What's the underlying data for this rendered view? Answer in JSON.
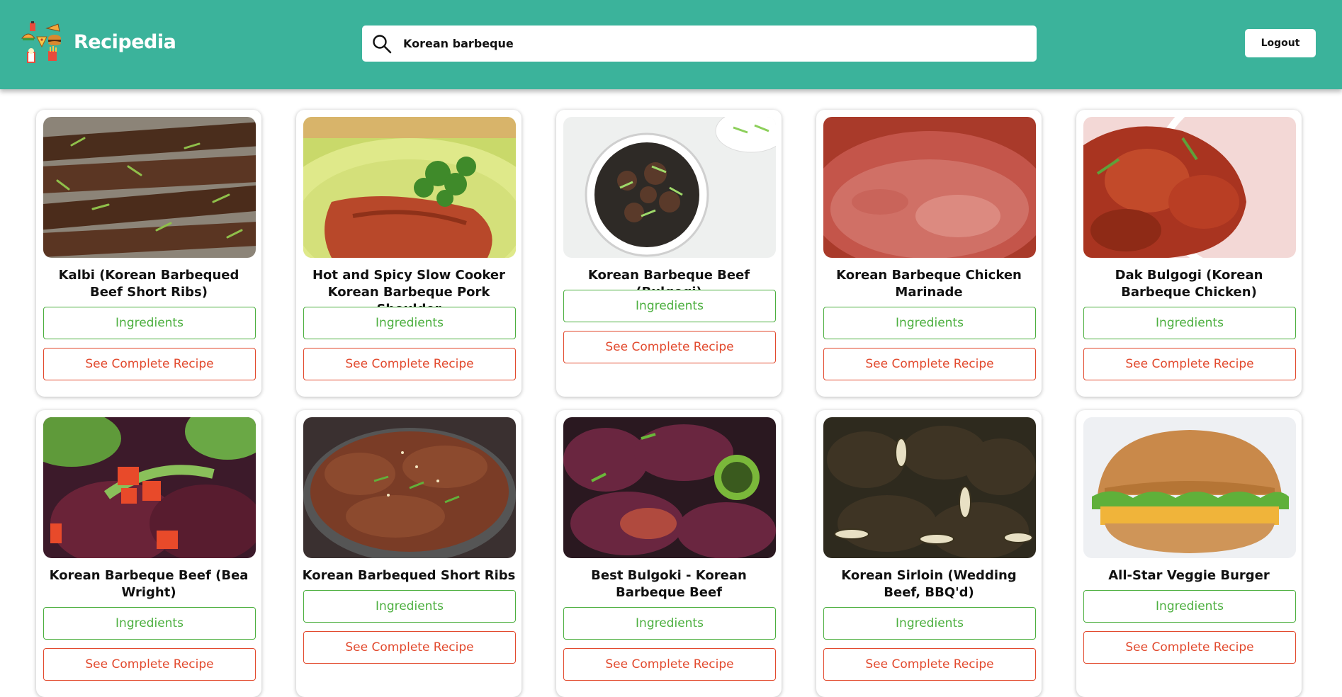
{
  "app": {
    "name": "Recipedia"
  },
  "search": {
    "value": "Korean barbeque"
  },
  "header": {
    "logout_label": "Logout"
  },
  "labels": {
    "ingredients": "Ingredients",
    "see_recipe": "See Complete Recipe"
  },
  "colors": {
    "header": "#3bb39b",
    "ingredients": "#4caf3f",
    "recipe": "#e24a2e"
  },
  "recipes": [
    {
      "title": "Kalbi (Korean Barbequed Beef Short Ribs)"
    },
    {
      "title": "Hot and Spicy Slow Cooker Korean Barbeque Pork Shoulder"
    },
    {
      "title": "Korean Barbeque Beef (Bulgogi)"
    },
    {
      "title": "Korean Barbeque Chicken Marinade"
    },
    {
      "title": "Dak Bulgogi (Korean Barbeque Chicken)"
    },
    {
      "title": "Korean Barbeque Beef (Bea Wright)"
    },
    {
      "title": "Korean Barbequed Short Ribs"
    },
    {
      "title": "Best Bulgoki - Korean Barbeque Beef"
    },
    {
      "title": "Korean Sirloin (Wedding Beef, BBQ'd)"
    },
    {
      "title": "All-Star Veggie Burger"
    }
  ]
}
